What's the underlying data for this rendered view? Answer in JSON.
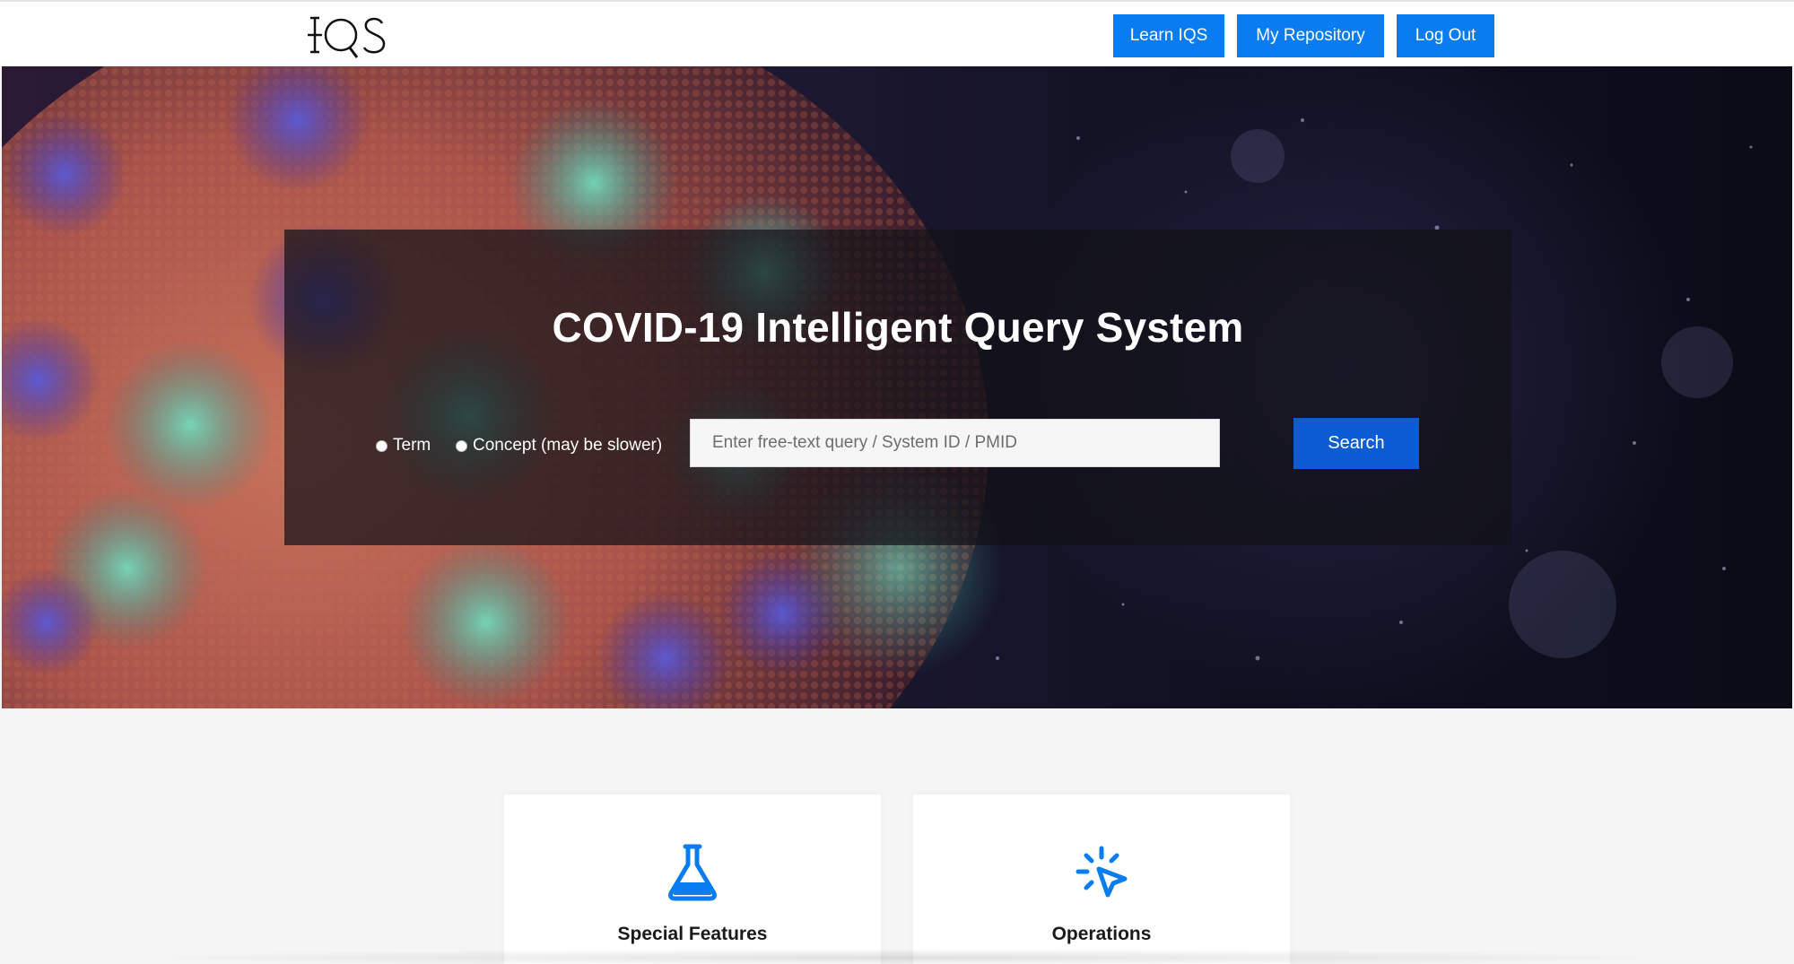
{
  "header": {
    "logo_text": "IQS",
    "nav": {
      "learn": "Learn IQS",
      "repository": "My Repository",
      "logout": "Log Out"
    }
  },
  "hero": {
    "title": "COVID-19 Intelligent Query System",
    "options": {
      "term": "Term",
      "concept": "Concept (may be slower)"
    },
    "search": {
      "placeholder": "Enter free-text query / System ID / PMID",
      "value": "",
      "button": "Search"
    }
  },
  "cards": [
    {
      "title": "Special Features",
      "icon": "flask-icon"
    },
    {
      "title": "Operations",
      "icon": "cursor-click-icon"
    }
  ],
  "colors": {
    "primary": "#0a7cf2",
    "search_button": "#0b5bd3",
    "page_background": "#f5f5f5"
  }
}
